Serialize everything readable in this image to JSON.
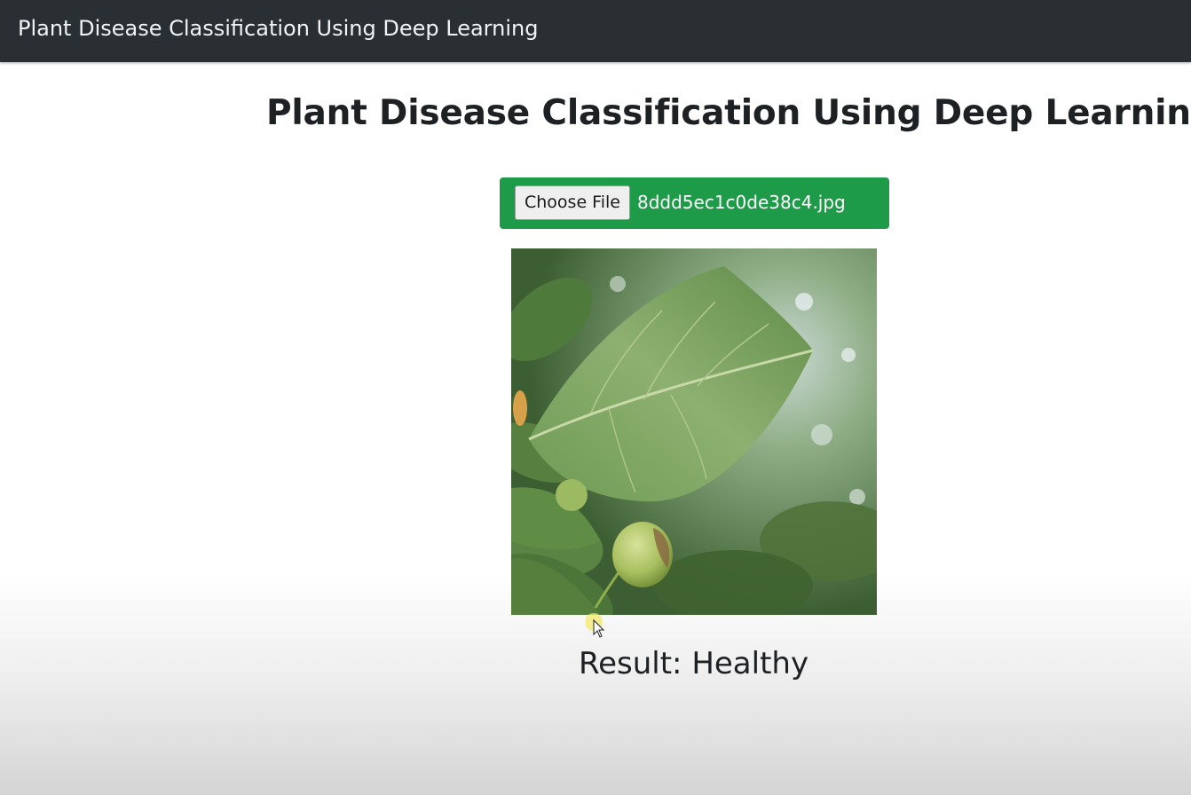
{
  "navbar": {
    "brand": "Plant Disease Classification Using Deep Learning"
  },
  "main": {
    "title": "Plant Disease Classification Using Deep Learning",
    "upload": {
      "button_label": "Choose File",
      "file_name": "8ddd5ec1c0de38c4.jpg"
    },
    "result_text": "Result: Healthy"
  },
  "colors": {
    "navbar_bg": "#2a2f33",
    "upload_bg": "#1e9b48",
    "text_dark": "#1d2124"
  }
}
